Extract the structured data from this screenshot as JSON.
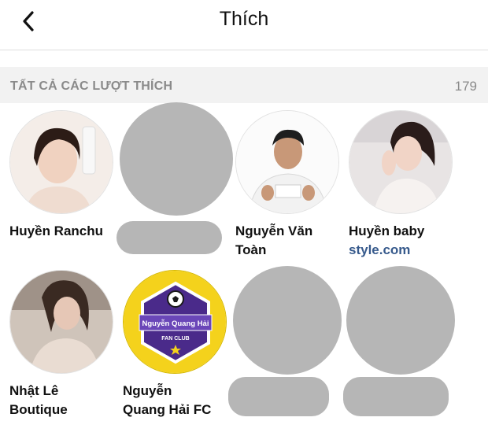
{
  "header": {
    "title": "Thích",
    "back_icon": "chevron-left-icon"
  },
  "section": {
    "title": "TẤT CẢ CÁC LƯỢT THÍCH",
    "count": "179"
  },
  "likes": [
    {
      "name": "Huyền Ranchu"
    },
    {
      "name": "Nguyễn Văn\nToàn"
    },
    {
      "name": "Huyền baby",
      "sub": "style.com"
    },
    {
      "name": "Nhật Lê\nBoutique"
    },
    {
      "name": "Nguyễn\nQuang Hải FC"
    }
  ],
  "fanclub_logo": {
    "title": "Nguyễn Quang Hải",
    "subtitle": "FAN CLUB"
  },
  "colors": {
    "link": "#375a8c",
    "redacted": "#b6b6b6",
    "logo_purple": "#4a2a8a",
    "logo_yellow": "#f4d21c"
  }
}
